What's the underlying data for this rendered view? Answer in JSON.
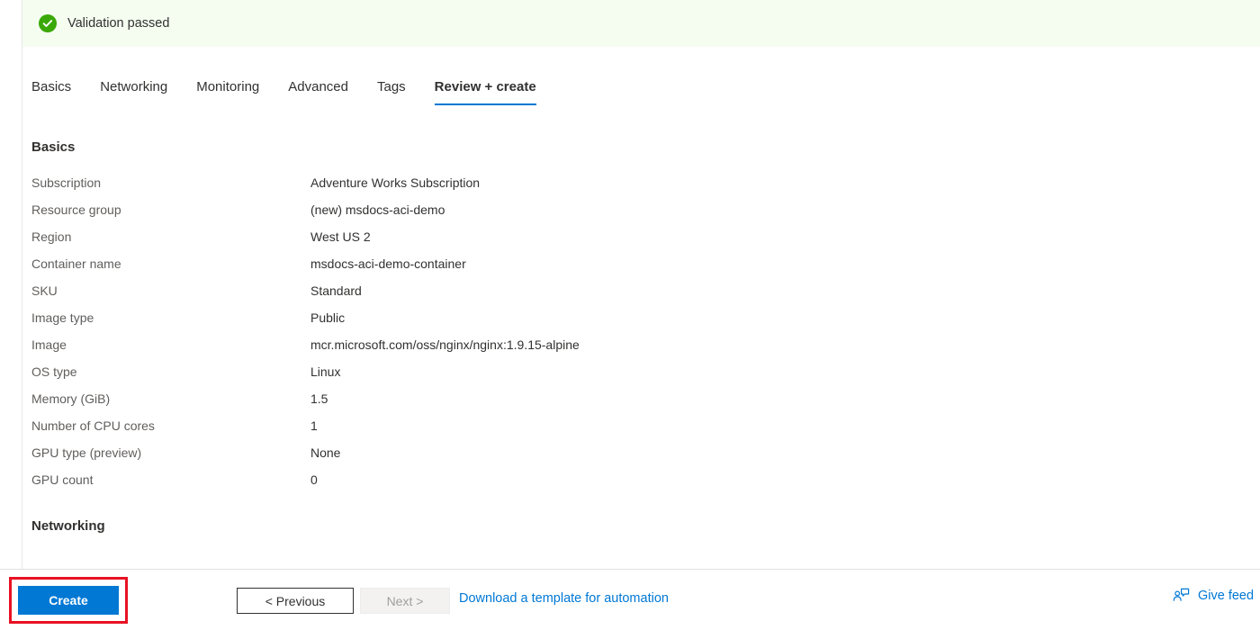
{
  "banner": {
    "icon": "check-circle-icon",
    "text": "Validation passed",
    "bg_color": "#f4fdf0",
    "icon_color": "#3aa808"
  },
  "tabs": [
    {
      "label": "Basics",
      "selected": false
    },
    {
      "label": "Networking",
      "selected": false
    },
    {
      "label": "Monitoring",
      "selected": false
    },
    {
      "label": "Advanced",
      "selected": false
    },
    {
      "label": "Tags",
      "selected": false
    },
    {
      "label": "Review + create",
      "selected": true
    }
  ],
  "sections": {
    "basics_title": "Basics",
    "networking_title": "Networking",
    "basics_rows": [
      {
        "label": "Subscription",
        "value": "Adventure Works Subscription"
      },
      {
        "label": "Resource group",
        "value": "(new) msdocs-aci-demo"
      },
      {
        "label": "Region",
        "value": "West US 2"
      },
      {
        "label": "Container name",
        "value": "msdocs-aci-demo-container"
      },
      {
        "label": "SKU",
        "value": "Standard"
      },
      {
        "label": "Image type",
        "value": "Public"
      },
      {
        "label": "Image",
        "value": "mcr.microsoft.com/oss/nginx/nginx:1.9.15-alpine"
      },
      {
        "label": "OS type",
        "value": "Linux"
      },
      {
        "label": "Memory (GiB)",
        "value": "1.5"
      },
      {
        "label": "Number of CPU cores",
        "value": "1"
      },
      {
        "label": "GPU type (preview)",
        "value": "None"
      },
      {
        "label": "GPU count",
        "value": "0"
      }
    ]
  },
  "footer": {
    "create_label": "Create",
    "previous_label": "< Previous",
    "next_label": "Next >",
    "next_disabled": true,
    "template_link": "Download a template for automation",
    "feedback_label": "Give feed",
    "feedback_icon": "person-feedback-icon",
    "accent_color": "#0078d4",
    "highlight_color": "#e81123"
  }
}
